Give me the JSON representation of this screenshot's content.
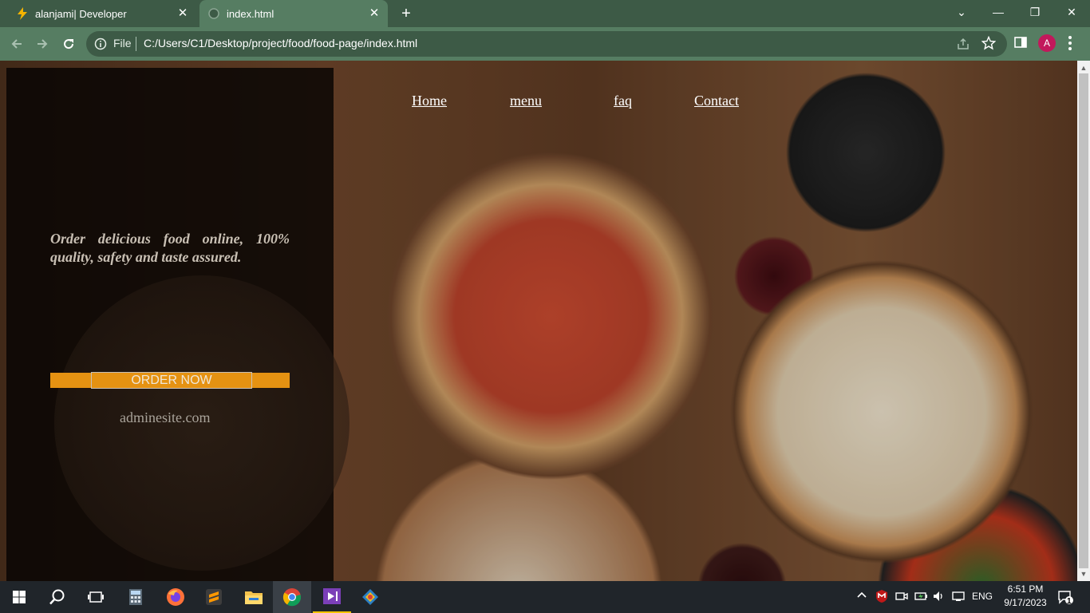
{
  "browser": {
    "tabs": [
      {
        "title": "alanjami| Developer",
        "icon": "bolt-icon",
        "close": "✕"
      },
      {
        "title": "index.html",
        "icon": "globe-icon",
        "close": "✕"
      }
    ],
    "new_tab": "+",
    "window_controls": {
      "list": "⌄",
      "minimize": "—",
      "restore": "❐",
      "close": "✕"
    },
    "address": {
      "scheme": "File",
      "url": "C:/Users/C1/Desktop/project/food/food-page/index.html"
    },
    "profile_initial": "A",
    "accent": "#567d62"
  },
  "page": {
    "nav": [
      "Home",
      "menu",
      "faq",
      "Contact"
    ],
    "tagline": "Order delicious food online, 100% quality, safety and taste assured.",
    "order_button": "ORDER NOW",
    "site": "adminesite.com",
    "accent": "#e59212"
  },
  "taskbar": {
    "icons": [
      "windows-start-icon",
      "search-icon",
      "task-view-icon",
      "calculator-icon",
      "firefox-icon",
      "sublime-text-icon",
      "file-explorer-icon",
      "chrome-icon",
      "visual-studio-icon",
      "git-icon"
    ],
    "tray": {
      "language": "ENG"
    },
    "clock": {
      "time": "6:51 PM",
      "date": "9/17/2023"
    },
    "notifications": "1"
  }
}
